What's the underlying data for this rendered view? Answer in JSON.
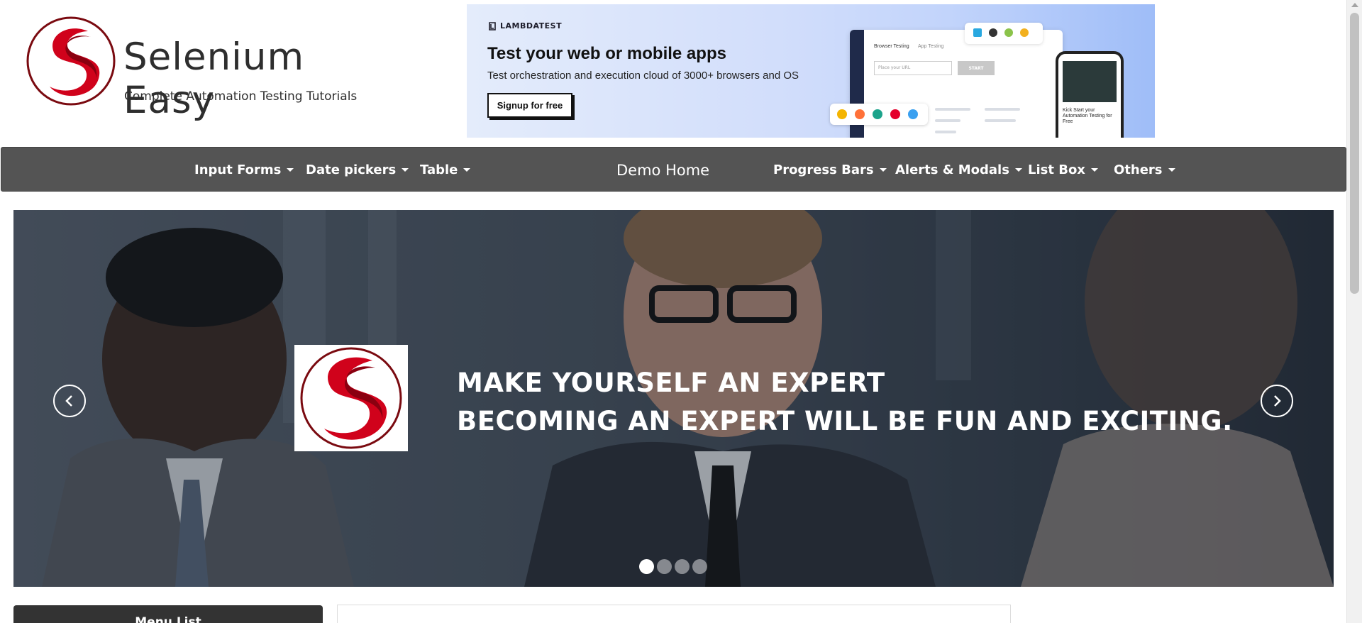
{
  "header": {
    "logo_title": "Selenium Easy",
    "logo_tagline": "Complete Automation Testing Tutorials"
  },
  "ad": {
    "brand": "LAMBDATEST",
    "title": "Test your web or mobile apps",
    "subtitle": "Test orchestration and execution cloud of 3000+ browsers and OS",
    "button_label": "Signup for free",
    "mock_tab_1": "Browser Testing",
    "mock_tab_2": "App Testing",
    "mock_input_placeholder": "Place your URL",
    "mock_start": "START",
    "phone_text": "Kick Start your Automation Testing for Free"
  },
  "nav": {
    "items": [
      {
        "label": "Input Forms"
      },
      {
        "label": "Date pickers"
      },
      {
        "label": "Table"
      },
      {
        "label": "Demo Home"
      },
      {
        "label": "Progress Bars"
      },
      {
        "label": "Alerts & Modals"
      },
      {
        "label": "List Box"
      },
      {
        "label": "Others"
      }
    ]
  },
  "hero": {
    "line1": "MAKE YOURSELF AN EXPERT",
    "line2": "BECOMING AN EXPERT WILL BE FUN AND EXCITING.",
    "slide_count": 4,
    "active_slide": 1
  },
  "sidebar": {
    "menu_title": "Menu List"
  },
  "colors": {
    "nav_bg": "#545454",
    "brand_red": "#d0021b",
    "menu_bg": "#333333"
  }
}
